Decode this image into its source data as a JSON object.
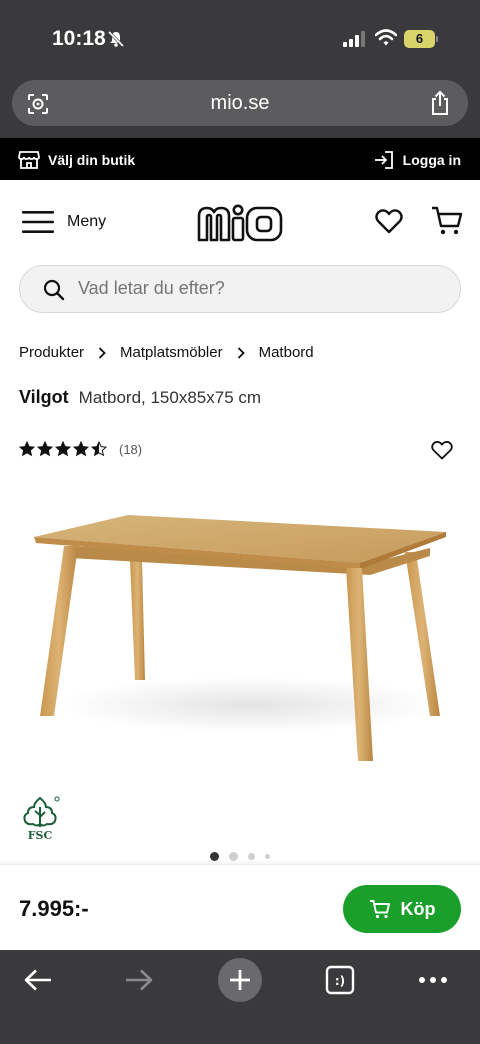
{
  "status_bar": {
    "time": "10:18",
    "battery": "6"
  },
  "browser": {
    "url": "mio.se"
  },
  "top_strip": {
    "store_label": "Välj din butik",
    "login_label": "Logga in"
  },
  "header": {
    "menu_label": "Meny",
    "logo_text": "mio"
  },
  "search": {
    "placeholder": "Vad letar du efter?"
  },
  "breadcrumb": [
    "Produkter",
    "Matplatsmöbler",
    "Matbord"
  ],
  "product": {
    "name": "Vilgot",
    "description": "Matbord, 150x85x75 cm",
    "rating": 4.5,
    "max_rating": 5,
    "review_count": "(18)",
    "fsc_label": "FSC",
    "gallery_count": 4,
    "gallery_active": 1
  },
  "purchase": {
    "price": "7.995:-",
    "buy_label": "Köp"
  },
  "colors": {
    "accent_green": "#1aa02a",
    "chrome_gray": "#3a3a3c"
  },
  "icons": [
    "bell-slash-icon",
    "signal-icon",
    "wifi-icon",
    "battery-icon",
    "page-settings-icon",
    "share-icon",
    "store-icon",
    "login-icon",
    "hamburger-icon",
    "heart-icon",
    "cart-icon",
    "search-icon",
    "chevron-right-icon",
    "star-icon",
    "fsc-tree-icon",
    "back-arrow-icon",
    "forward-arrow-icon",
    "plus-icon",
    "tabs-icon",
    "more-icon"
  ]
}
